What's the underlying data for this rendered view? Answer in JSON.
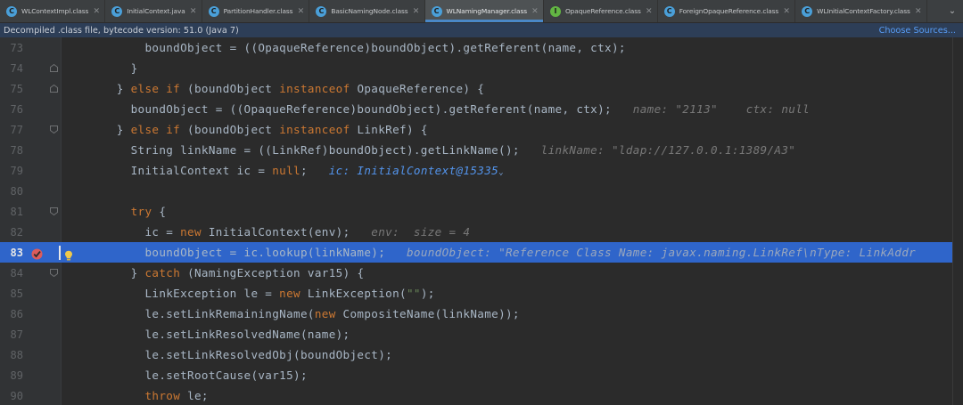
{
  "tabs": [
    {
      "label": "WLContextImpl.class",
      "icon": "class-icon",
      "icon_color": "#4a9fd8",
      "icon_glyph": "C",
      "active": false
    },
    {
      "label": "InitialContext.java",
      "icon": "class-icon",
      "icon_color": "#4a9fd8",
      "icon_glyph": "C",
      "active": false
    },
    {
      "label": "PartitionHandler.class",
      "icon": "class-icon",
      "icon_color": "#4a9fd8",
      "icon_glyph": "C",
      "active": false
    },
    {
      "label": "BasicNamingNode.class",
      "icon": "class-icon",
      "icon_color": "#4a9fd8",
      "icon_glyph": "C",
      "active": false
    },
    {
      "label": "WLNamingManager.class",
      "icon": "class-icon",
      "icon_color": "#4a9fd8",
      "icon_glyph": "C",
      "active": true
    },
    {
      "label": "OpaqueReference.class",
      "icon": "interface-icon",
      "icon_color": "#62b543",
      "icon_glyph": "I",
      "active": false
    },
    {
      "label": "ForeignOpaqueReference.class",
      "icon": "class-icon",
      "icon_color": "#4a9fd8",
      "icon_glyph": "C",
      "active": false
    },
    {
      "label": "WLInitialContextFactory.class",
      "icon": "class-icon",
      "icon_color": "#4a9fd8",
      "icon_glyph": "C",
      "active": false
    }
  ],
  "tab_close_glyph": "✕",
  "tab_overflow_glyph": "⌄",
  "banner": {
    "text": "Decompiled .class file, bytecode version: 51.0 (Java 7)",
    "link": "Choose Sources..."
  },
  "colors": {
    "keyword": "#cc7832",
    "string": "#6a8759",
    "plain": "#a9b7c6",
    "hint": "#787878",
    "current_line": "#2f65ca",
    "breakpoint": "#db5c5c"
  },
  "current_line": 83,
  "lines": [
    {
      "num": "73",
      "fold": "none",
      "tokens": [
        [
          "p",
          "        boundObject = ((OpaqueReference)boundObject).getReferent(name, ctx);"
        ]
      ]
    },
    {
      "num": "74",
      "fold": "end",
      "tokens": [
        [
          "p",
          "      }"
        ]
      ]
    },
    {
      "num": "75",
      "fold": "end",
      "tokens": [
        [
          "p",
          "    } "
        ],
        [
          "k",
          "else if"
        ],
        [
          "p",
          " (boundObject "
        ],
        [
          "k",
          "instanceof"
        ],
        [
          "p",
          " OpaqueReference) {"
        ]
      ]
    },
    {
      "num": "76",
      "fold": "none",
      "tokens": [
        [
          "p",
          "      boundObject = ((OpaqueReference)boundObject).getReferent(name, ctx);"
        ],
        [
          "h",
          "   name: \"2113\"    ctx: null"
        ]
      ]
    },
    {
      "num": "77",
      "fold": "start",
      "tokens": [
        [
          "p",
          "    } "
        ],
        [
          "k",
          "else if"
        ],
        [
          "p",
          " (boundObject "
        ],
        [
          "k",
          "instanceof"
        ],
        [
          "p",
          " LinkRef) {"
        ]
      ]
    },
    {
      "num": "78",
      "fold": "none",
      "tokens": [
        [
          "p",
          "      String linkName = ((LinkRef)boundObject).getLinkName();"
        ],
        [
          "h",
          "   linkName: \"ldap://127.0.0.1:1389/A3\""
        ]
      ]
    },
    {
      "num": "79",
      "fold": "none",
      "tokens": [
        [
          "p",
          "      InitialContext ic = "
        ],
        [
          "k",
          "null"
        ],
        [
          "p",
          ";"
        ],
        [
          "b",
          "   ic: InitialContext@15335"
        ],
        [
          "c",
          "⌄"
        ]
      ]
    },
    {
      "num": "80",
      "fold": "none",
      "tokens": [
        [
          "p",
          ""
        ]
      ]
    },
    {
      "num": "81",
      "fold": "start",
      "tokens": [
        [
          "p",
          "      "
        ],
        [
          "k",
          "try"
        ],
        [
          "p",
          " {"
        ]
      ]
    },
    {
      "num": "82",
      "fold": "none",
      "tokens": [
        [
          "p",
          "        ic = "
        ],
        [
          "k",
          "new"
        ],
        [
          "p",
          " InitialContext(env);"
        ],
        [
          "h",
          "   env:  size = 4"
        ]
      ]
    },
    {
      "num": "83",
      "fold": "none",
      "tokens": [
        [
          "p",
          "        boundObject = ic.lookup(linkName);"
        ],
        [
          "h",
          "   boundObject: \"Reference Class Name: javax.naming.LinkRef\\nType: LinkAddr"
        ]
      ]
    },
    {
      "num": "84",
      "fold": "start",
      "tokens": [
        [
          "p",
          "      } "
        ],
        [
          "k",
          "catch"
        ],
        [
          "p",
          " (NamingException var15) {"
        ]
      ]
    },
    {
      "num": "85",
      "fold": "none",
      "tokens": [
        [
          "p",
          "        LinkException le = "
        ],
        [
          "k",
          "new"
        ],
        [
          "p",
          " LinkException("
        ],
        [
          "s",
          "\"\""
        ],
        [
          "p",
          ");"
        ]
      ]
    },
    {
      "num": "86",
      "fold": "none",
      "tokens": [
        [
          "p",
          "        le.setLinkRemainingName("
        ],
        [
          "k",
          "new"
        ],
        [
          "p",
          " CompositeName(linkName));"
        ]
      ]
    },
    {
      "num": "87",
      "fold": "none",
      "tokens": [
        [
          "p",
          "        le.setLinkResolvedName(name);"
        ]
      ]
    },
    {
      "num": "88",
      "fold": "none",
      "tokens": [
        [
          "p",
          "        le.setLinkResolvedObj(boundObject);"
        ]
      ]
    },
    {
      "num": "89",
      "fold": "none",
      "tokens": [
        [
          "p",
          "        le.setRootCause(var15);"
        ]
      ]
    },
    {
      "num": "90",
      "fold": "none",
      "tokens": [
        [
          "p",
          "        "
        ],
        [
          "k",
          "throw"
        ],
        [
          "p",
          " le;"
        ]
      ]
    }
  ],
  "icons": {
    "breakpoint": "breakpoint-icon",
    "intention": "lightbulb-icon",
    "fold": "fold-marker-icon"
  }
}
